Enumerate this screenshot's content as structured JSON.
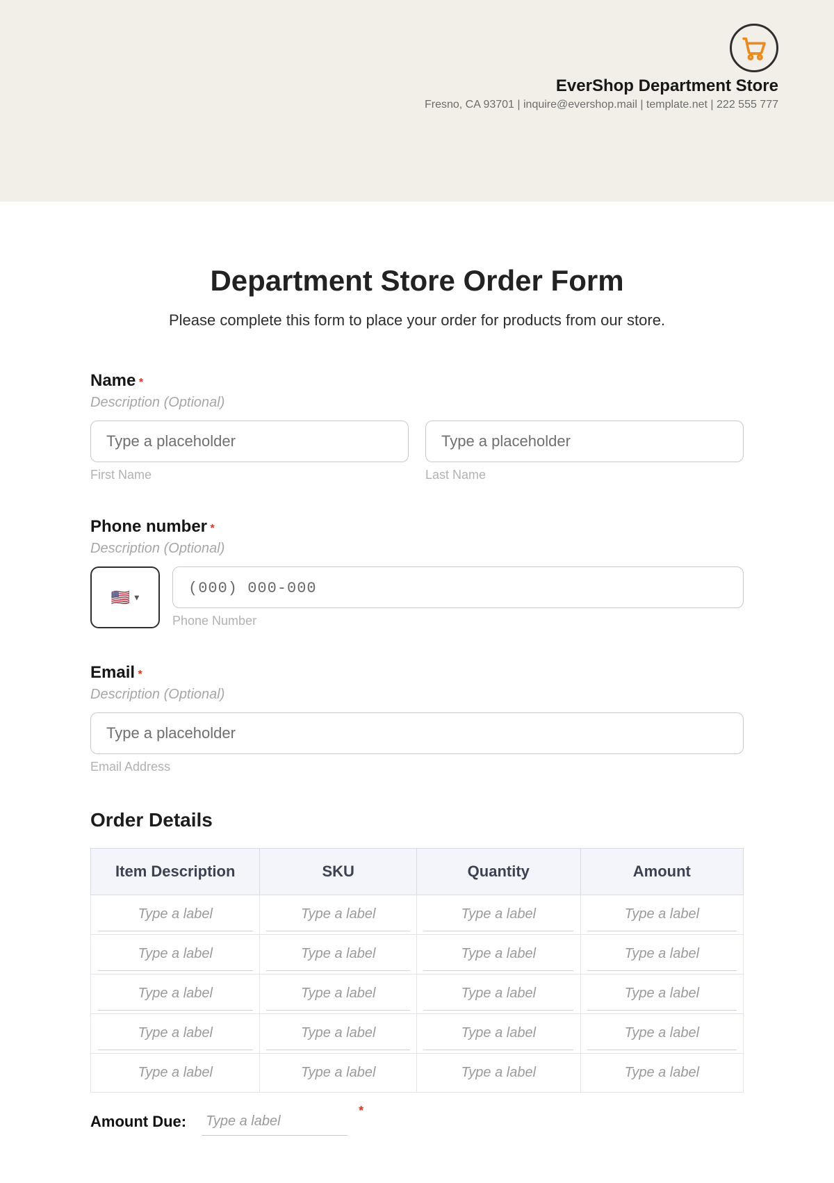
{
  "header": {
    "company": "EverShop Department Store",
    "meta": "Fresno, CA 93701 | inquire@evershop.mail | template.net | 222 555 777"
  },
  "form": {
    "title": "Department Store Order Form",
    "subtitle": "Please complete this form to place your order for products from our store."
  },
  "name": {
    "label": "Name",
    "required_mark": "*",
    "desc": "Description (Optional)",
    "first_ph": "Type a placeholder",
    "first_sub": "First Name",
    "last_ph": "Type a placeholder",
    "last_sub": "Last Name"
  },
  "phone": {
    "label": "Phone number",
    "required_mark": "*",
    "desc": "Description (Optional)",
    "country_flag": "🇺🇸",
    "input_ph": "(000) 000-000",
    "sub": "Phone Number"
  },
  "email": {
    "label": "Email",
    "required_mark": "*",
    "desc": "Description (Optional)",
    "ph": "Type a placeholder",
    "sub": "Email Address"
  },
  "order": {
    "heading": "Order Details",
    "headers": {
      "c0": "Item Description",
      "c1": "SKU",
      "c2": "Quantity",
      "c3": "Amount"
    },
    "cell_ph": "Type a label",
    "rows": 5
  },
  "amount_due": {
    "label": "Amount Due:",
    "ph": "Type a label",
    "required_mark": "*"
  }
}
